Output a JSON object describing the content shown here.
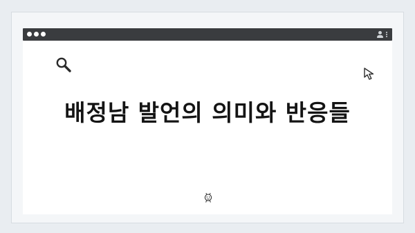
{
  "window": {
    "controls": [
      "close",
      "minimize",
      "maximize"
    ],
    "top_indicator_count": 4,
    "menu_icons": [
      "user-icon",
      "kebab-menu-icon"
    ]
  },
  "content": {
    "headline": "배정남 발언의 의미와 반응들",
    "icons": [
      "search-icon",
      "cursor-arrow-icon",
      "bug-face-icon"
    ]
  },
  "colors": {
    "background": "#e9edf1",
    "titlebar": "#3a3c3f",
    "content_background": "#ffffff",
    "headline_text": "#141414"
  }
}
